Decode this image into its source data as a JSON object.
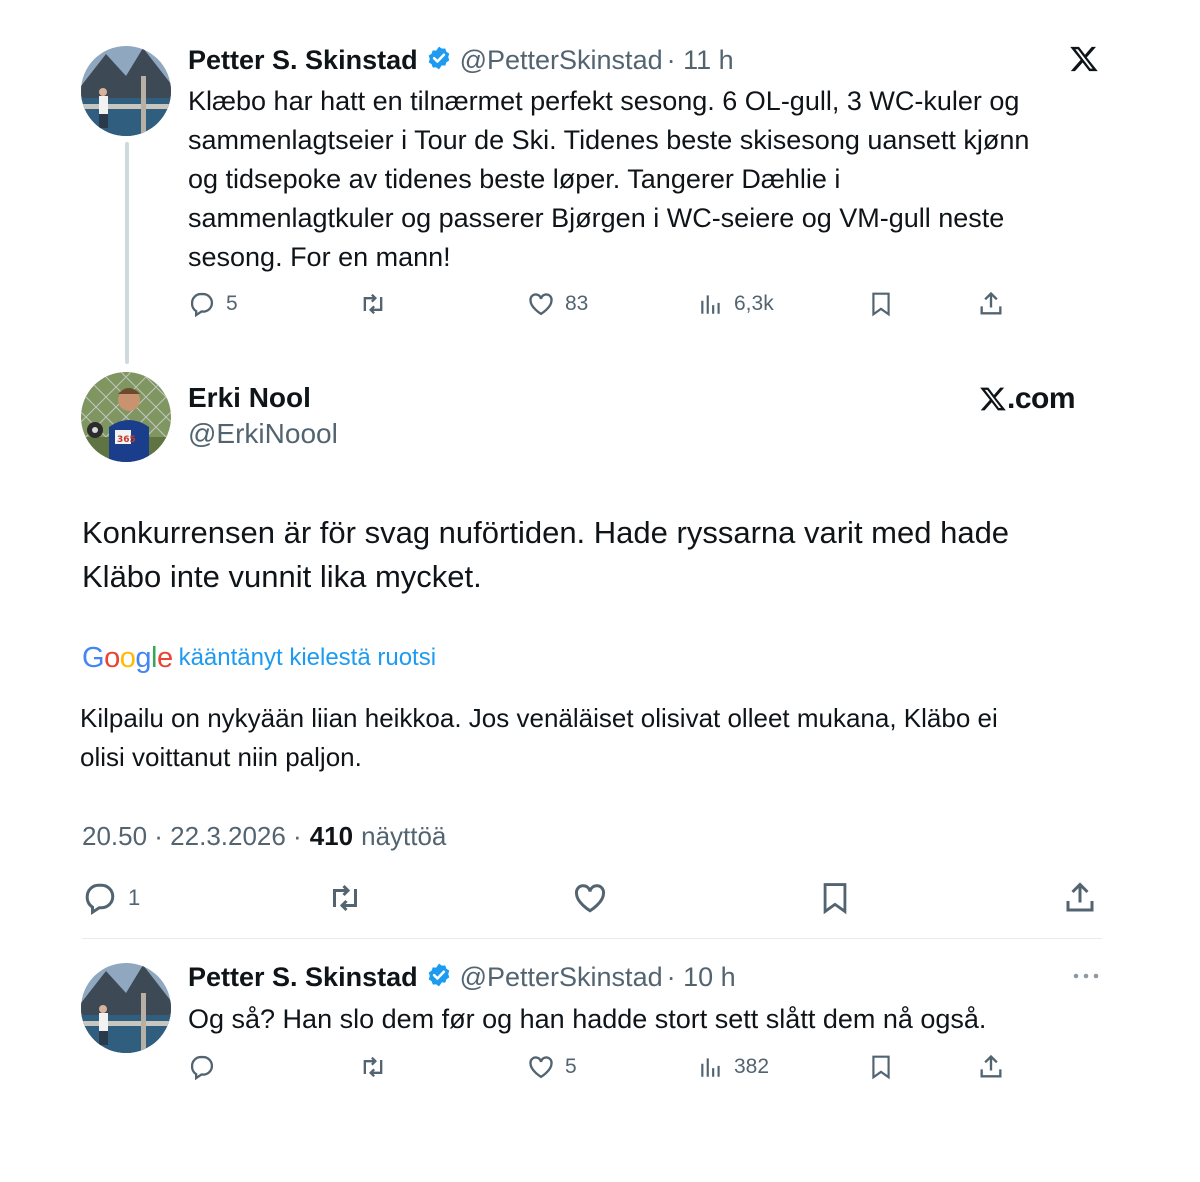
{
  "top_tweet": {
    "name": "Petter S. Skinstad",
    "handle": "@PetterSkinstad",
    "time": "· 11 h",
    "text_lines": [
      "Klæbo har hatt en tilnærmet perfekt sesong. 6 OL-gull, 3 WC-kuler og",
      "sammenlagtseier i Tour de Ski. Tidenes beste skisesong uansett kjønn",
      "og tidsepoke av tidenes beste løper. Tangerer Dæhlie i",
      "sammenlagtkuler og passerer Bjørgen i WC-seiere og VM-gull neste",
      "sesong. For en mann!"
    ],
    "reply_count": "5",
    "like_count": "83",
    "views": "6,3k"
  },
  "main_tweet": {
    "name": "Erki Nool",
    "handle": "@ErkiNoool",
    "xcom_label": ".com",
    "text_lines": [
      "Konkurrensen är för svag nuförtiden. Hade ryssarna varit med hade",
      "Kläbo inte vunnit lika mycket."
    ],
    "google_logo": "Google",
    "translated_label": "kääntänyt kielestä ruotsi",
    "translation_lines": [
      "Kilpailu on nykyään liian heikkoa. Jos venäläiset olisivat olleet mukana, Kläbo ei",
      "olisi voittanut niin paljon."
    ],
    "timestamp": "20.50 · 22.3.2026 ·",
    "view_count": "410",
    "views_label": "näyttöä",
    "reply_count": "1"
  },
  "reply_tweet": {
    "name": "Petter S. Skinstad",
    "handle": "@PetterSkinstad",
    "time": "· 10 h",
    "text": "Og så? Han slo dem før og han hadde stort sett slått dem nå også.",
    "like_count": "5",
    "views": "382"
  },
  "colors": {
    "verified": "#1d9bf0",
    "secondary": "#536471",
    "translate_link": "#1d9bf0"
  }
}
